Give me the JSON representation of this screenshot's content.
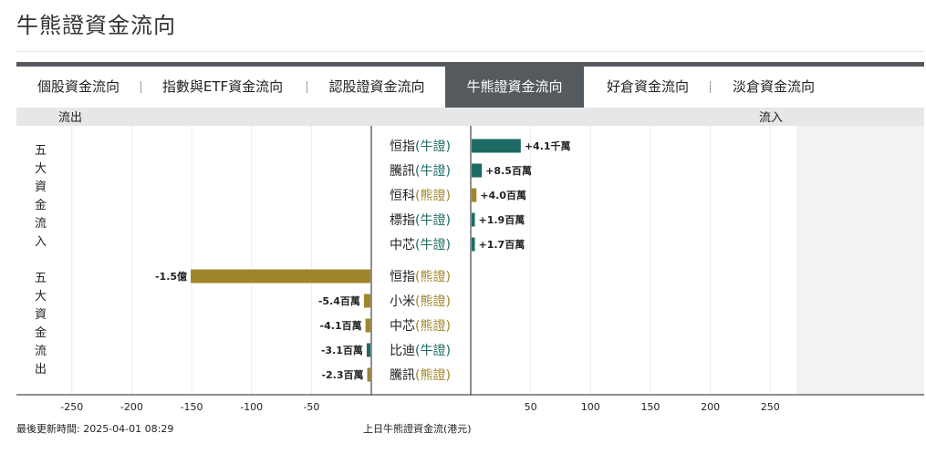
{
  "page": {
    "title": "牛熊證資金流向",
    "update_time": "最後更新時間: 2025-04-01 08:29",
    "caption": "上日牛熊證資金流(港元)"
  },
  "tabs": [
    {
      "label": "個股資金流向",
      "active": false
    },
    {
      "label": "指數與ETF資金流向",
      "active": false
    },
    {
      "label": "認股證資金流向",
      "active": false
    },
    {
      "label": "牛熊證資金流向",
      "active": true
    },
    {
      "label": "好倉資金流向",
      "active": false
    },
    {
      "label": "淡倉資金流向",
      "active": false
    }
  ],
  "chart_data": {
    "type": "bar",
    "orientation": "horizontal-diverging",
    "header_left": "流出",
    "header_right": "流入",
    "section_labels": [
      "五大資金流入",
      "五大資金流出"
    ],
    "xlim": [
      -270,
      270
    ],
    "x_ticks": [
      -250,
      -200,
      -150,
      -100,
      -50,
      50,
      100,
      150,
      200,
      250
    ],
    "colors": {
      "bull": "#1e6b66",
      "bear": "#a0862a"
    },
    "inflow": [
      {
        "underlying": "恒指",
        "type": "牛證",
        "value": 41,
        "label": "+4.1千萬"
      },
      {
        "underlying": "騰訊",
        "type": "牛證",
        "value": 8.5,
        "label": "+8.5百萬"
      },
      {
        "underlying": "恒科",
        "type": "熊證",
        "value": 4.0,
        "label": "+4.0百萬"
      },
      {
        "underlying": "標指",
        "type": "牛證",
        "value": 1.9,
        "label": "+1.9百萬"
      },
      {
        "underlying": "中芯",
        "type": "牛證",
        "value": 1.7,
        "label": "+1.7百萬"
      }
    ],
    "outflow": [
      {
        "underlying": "恒指",
        "type": "熊證",
        "value": -150,
        "label": "-1.5億"
      },
      {
        "underlying": "小米",
        "type": "熊證",
        "value": -5.4,
        "label": "-5.4百萬"
      },
      {
        "underlying": "中芯",
        "type": "熊證",
        "value": -4.1,
        "label": "-4.1百萬"
      },
      {
        "underlying": "比迪",
        "type": "牛證",
        "value": -3.1,
        "label": "-3.1百萬"
      },
      {
        "underlying": "騰訊",
        "type": "熊證",
        "value": -2.3,
        "label": "-2.3百萬"
      }
    ]
  }
}
